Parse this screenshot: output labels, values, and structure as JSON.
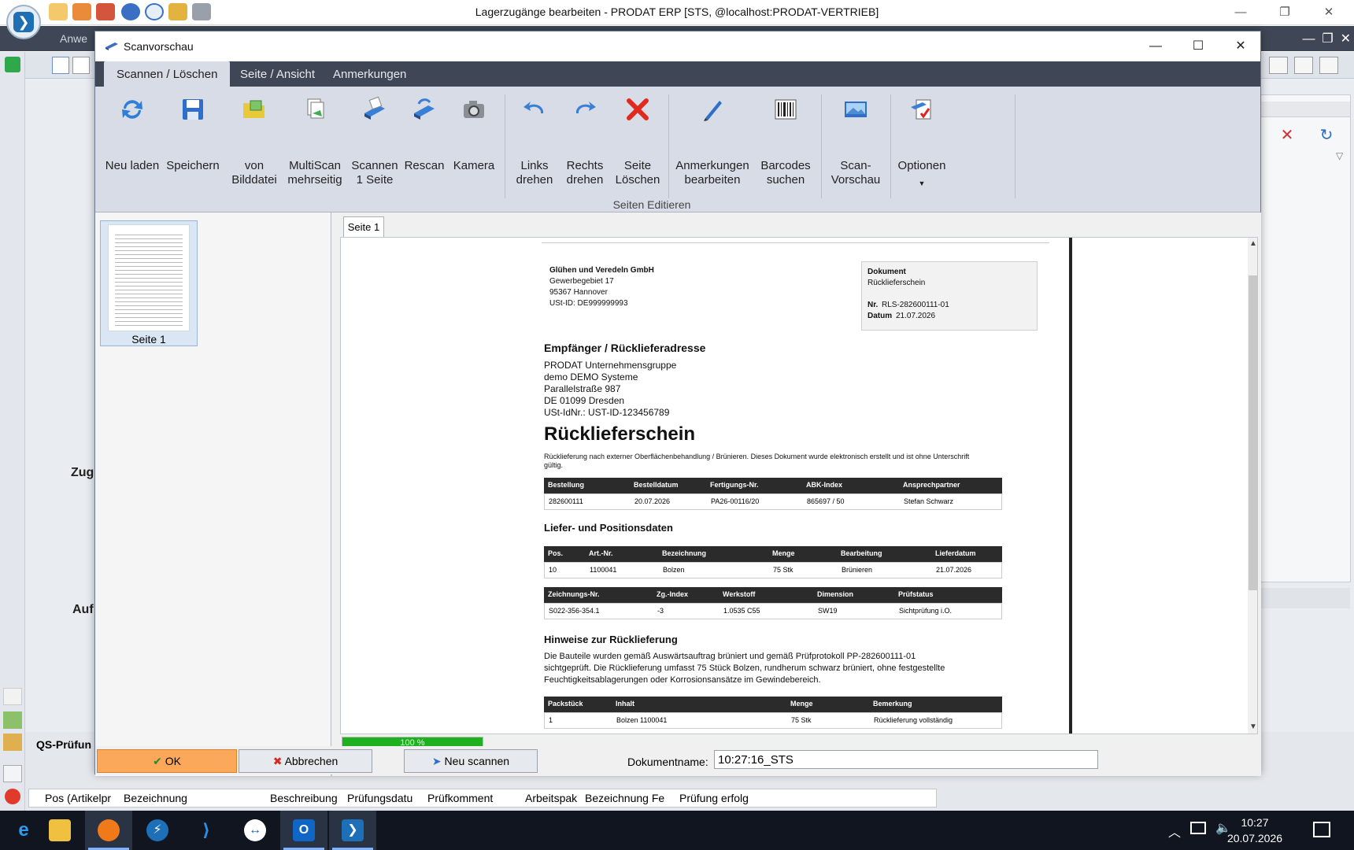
{
  "app": {
    "title": "Lagerzugänge bearbeiten - PRODAT ERP   [STS,  @localhost:PRODAT-VERTRIEB]",
    "menu_anw": "Anwe",
    "left_label_zug": "Zug",
    "left_label_auf": "Auf",
    "qs_label": "QS-Prüfun",
    "bottom_columns": [
      "Pos (Artikelpr",
      "Bezeichnung",
      "Beschreibung",
      "Prüfungsdatu",
      "Prüfkomment",
      "Arbeitspak",
      "Bezeichnung Fe",
      "Prüfung erfolg"
    ]
  },
  "dialog": {
    "title": "Scanvorschau",
    "tabs": [
      "Scannen / Löschen",
      "Seite / Ansicht",
      "Anmerkungen"
    ],
    "ribbon": {
      "buttons": [
        {
          "label": "Neu laden"
        },
        {
          "label": "Speichern"
        },
        {
          "label": "von\nBilddatei"
        },
        {
          "label": "MultiScan\nmehrseitig"
        },
        {
          "label": "Scannen\n1 Seite"
        },
        {
          "label": "Rescan"
        },
        {
          "label": "Kamera"
        },
        {
          "label": "Links\ndrehen"
        },
        {
          "label": "Rechts\ndrehen"
        },
        {
          "label": "Seite\nLöschen"
        },
        {
          "label": "Anmerkungen\nbearbeiten"
        },
        {
          "label": "Barcodes\nsuchen"
        },
        {
          "label": "Scan-\nVorschau"
        },
        {
          "label": "Optionen"
        }
      ],
      "group_label": "Seiten Editieren"
    },
    "thumbnail_label": "Seite 1",
    "page_tab": "Seite 1",
    "progress": {
      "percent": 100,
      "text": "100 %"
    },
    "actions": {
      "ok": "OK",
      "cancel": "Abbrechen",
      "rescan": "Neu scannen"
    },
    "docname_label": "Dokumentname:",
    "docname_value": "10:27:16_STS"
  },
  "doc": {
    "sender": [
      "Glühen und Veredeln GmbH",
      "Gewerbegebiet 17",
      "95367 Hannover",
      "USt-ID: DE999999993"
    ],
    "box": {
      "title": "Dokument",
      "type": "Rücklieferschein",
      "nr_label": "Nr.",
      "nr_value": "RLS-282600111-01",
      "date_label": "Datum",
      "date_value": "21.07.2026"
    },
    "recipient_heading": "Empfänger / Rücklieferadresse",
    "recipient": [
      "PRODAT Unternehmensgruppe",
      "demo DEMO Systeme",
      "Parallelstraße 987",
      "DE 01099 Dresden",
      "USt-IdNr.: UST-ID-123456789"
    ],
    "main_title": "Rücklieferschein",
    "intro": [
      "Rücklieferung nach externer Oberflächenbehandlung / Brünieren. Dieses Dokument wurde elektronisch erstellt und ist ohne Unterschrift",
      "gültig."
    ],
    "table1": {
      "headers": [
        "Bestellung",
        "Bestelldatum",
        "Fertigungs-Nr.",
        "ABK-Index",
        "Ansprechpartner"
      ],
      "row": [
        "282600111",
        "20.07.2026",
        "PA26-00116/20",
        "865697 / 50",
        "Stefan Schwarz"
      ]
    },
    "section2": "Liefer- und Positionsdaten",
    "table2": {
      "headers": [
        "Pos.",
        "Art.-Nr.",
        "Bezeichnung",
        "Menge",
        "Bearbeitung",
        "Lieferdatum"
      ],
      "row": [
        "10",
        "1100041",
        "Bolzen",
        "75 Stk",
        "Brünieren",
        "21.07.2026"
      ]
    },
    "table3": {
      "headers": [
        "Zeichnungs-Nr.",
        "Zg.-Index",
        "Werkstoff",
        "Dimension",
        "Prüfstatus"
      ],
      "row": [
        "S022-356-354.1",
        "-3",
        "1.0535 C55",
        "SW19",
        "Sichtprüfung i.O."
      ]
    },
    "section3": "Hinweise zur Rücklieferung",
    "notes": [
      "Die Bauteile wurden gemäß Auswärtsauftrag brüniert und gemäß Prüfprotokoll PP-282600111-01",
      "sichtgeprüft. Die Rücklieferung umfasst 75 Stück Bolzen, rundherum schwarz brüniert, ohne festgestellte",
      "Feuchtigkeitsablagerungen oder Korrosionsansätze im Gewindebereich."
    ],
    "table4": {
      "headers": [
        "Packstück",
        "Inhalt",
        "Menge",
        "Bemerkung"
      ],
      "row": [
        "1",
        "Bolzen 1100041",
        "75 Stk",
        "Rücklieferung vollständig"
      ]
    }
  },
  "taskbar": {
    "time": "10:27",
    "date": "20.07.2026"
  },
  "colors": {
    "accent": "#3f4756",
    "ok_button": "#fca85a",
    "progress": "#1fb01f"
  }
}
